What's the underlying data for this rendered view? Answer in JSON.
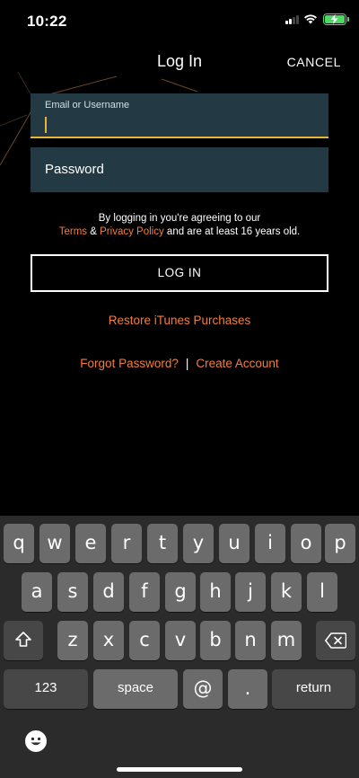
{
  "status_bar": {
    "time": "10:22"
  },
  "nav": {
    "title": "Log In",
    "cancel_label": "CANCEL"
  },
  "form": {
    "email_label": "Email or Username",
    "password_placeholder": "Password"
  },
  "agreement": {
    "line1": "By logging in you're agreeing to our",
    "terms": "Terms",
    "amp": "&",
    "privacy": "Privacy Policy",
    "tail": "and are at least 16 years old."
  },
  "login_label": "LOG IN",
  "restore_label": "Restore iTunes Purchases",
  "forgot_label": "Forgot Password?",
  "separator": "|",
  "create_label": "Create Account",
  "keyboard": {
    "row1": [
      "q",
      "w",
      "e",
      "r",
      "t",
      "y",
      "u",
      "i",
      "o",
      "p"
    ],
    "row2": [
      "a",
      "s",
      "d",
      "f",
      "g",
      "h",
      "j",
      "k",
      "l"
    ],
    "row3": [
      "z",
      "x",
      "c",
      "v",
      "b",
      "n",
      "m"
    ],
    "numbers": "123",
    "space": "space",
    "at": "@",
    "dot": ".",
    "return": "return"
  },
  "colors": {
    "accent": "#f47d3a",
    "field_bg": "#233944",
    "focus_underline": "#e9b43c"
  }
}
